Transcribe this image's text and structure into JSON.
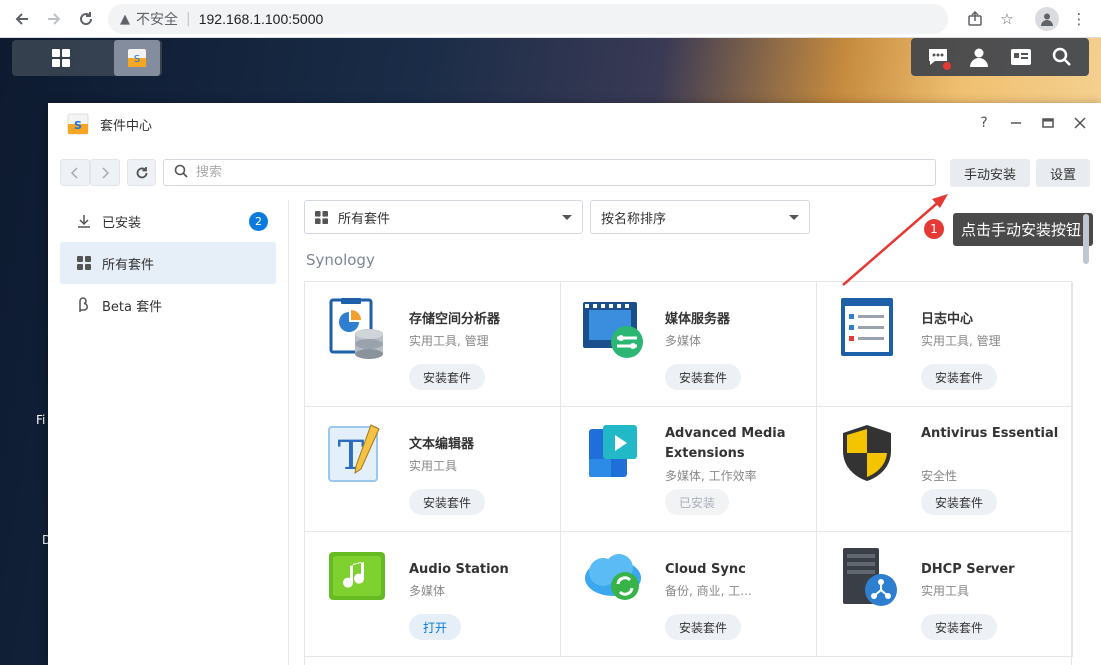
{
  "browser": {
    "insecure_label": "不安全",
    "url": "192.168.1.100:5000"
  },
  "window": {
    "title": "套件中心",
    "help": "?",
    "manual_install_label": "手动安装",
    "settings_label": "设置",
    "search_placeholder": "搜索"
  },
  "sidebar": {
    "items": [
      {
        "label": "已安装",
        "badge": "2"
      },
      {
        "label": "所有套件"
      },
      {
        "label": "Beta 套件"
      }
    ]
  },
  "filters": {
    "category": "所有套件",
    "sort": "按名称排序"
  },
  "section_title": "Synology",
  "packages": [
    {
      "name": "存储空间分析器",
      "category": "实用工具, 管理",
      "action": "安装套件"
    },
    {
      "name": "媒体服务器",
      "category": "多媒体",
      "action": "安装套件"
    },
    {
      "name": "日志中心",
      "category": "实用工具, 管理",
      "action": "安装套件"
    },
    {
      "name": "文本编辑器",
      "category": "实用工具",
      "action": "安装套件"
    },
    {
      "name": "Advanced Media Extensions",
      "category": "多媒体, 工作效率",
      "action": "已安装"
    },
    {
      "name": "Antivirus Essential",
      "category": "安全性",
      "action": "安装套件"
    },
    {
      "name": "Audio Station",
      "category": "多媒体",
      "action": "打开"
    },
    {
      "name": "Cloud Sync",
      "category": "备份, 商业, 工...",
      "action": "安装套件"
    },
    {
      "name": "DHCP Server",
      "category": "实用工具",
      "action": "安装套件"
    }
  ],
  "annotation": {
    "step": "1",
    "text": "点击手动安装按钮",
    "color": "#e53935"
  },
  "desktop": {
    "label_fi": "Fi",
    "label_d": "D"
  }
}
